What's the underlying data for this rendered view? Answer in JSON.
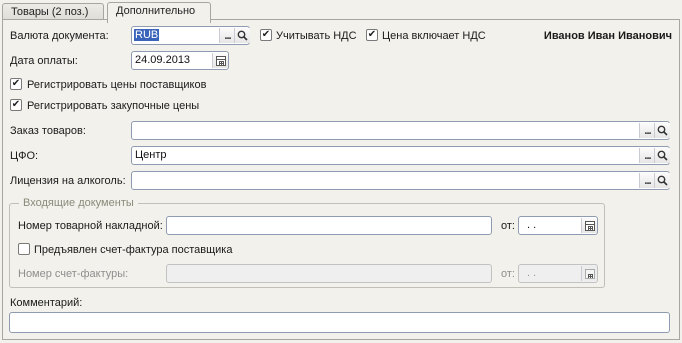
{
  "tabs": [
    {
      "label": "Товары (2 поз.)"
    },
    {
      "label": "Дополнительно"
    }
  ],
  "user_name": "Иванов Иван Иванович",
  "currency": {
    "label": "Валюта документа:",
    "value": "RUB"
  },
  "vat_checkbox": {
    "label": "Учитывать НДС",
    "checked": true
  },
  "price_includes_vat": {
    "label": "Цена включает НДС",
    "checked": true
  },
  "payment_date": {
    "label": "Дата оплаты:",
    "value": "24.09.2013"
  },
  "register_supplier_prices": {
    "label": "Регистрировать цены поставщиков",
    "checked": true
  },
  "register_purchase_prices": {
    "label": "Регистрировать закупочные цены",
    "checked": true
  },
  "goods_order": {
    "label": "Заказ товаров:",
    "value": ""
  },
  "cfo": {
    "label": "ЦФО:",
    "value": "Центр"
  },
  "alcohol_license": {
    "label": "Лицензия на алкоголь:",
    "value": ""
  },
  "incoming_docs": {
    "title": "Входящие документы",
    "waybill_number": {
      "label": "Номер товарной накладной:",
      "value": ""
    },
    "waybill_from": {
      "label": "от:",
      "value": " .  ."
    },
    "invoice_presented": {
      "label": "Предъявлен счет-фактура поставщика",
      "checked": false
    },
    "invoice_number": {
      "label": "Номер счет-фактуры:",
      "value": ""
    },
    "invoice_from": {
      "label": "от:",
      "value": " .  ."
    }
  },
  "comment": {
    "label": "Комментарий:",
    "value": ""
  },
  "icons": {
    "select": "ellipsis-icon",
    "search": "search-icon",
    "calendar": "calendar-icon"
  }
}
